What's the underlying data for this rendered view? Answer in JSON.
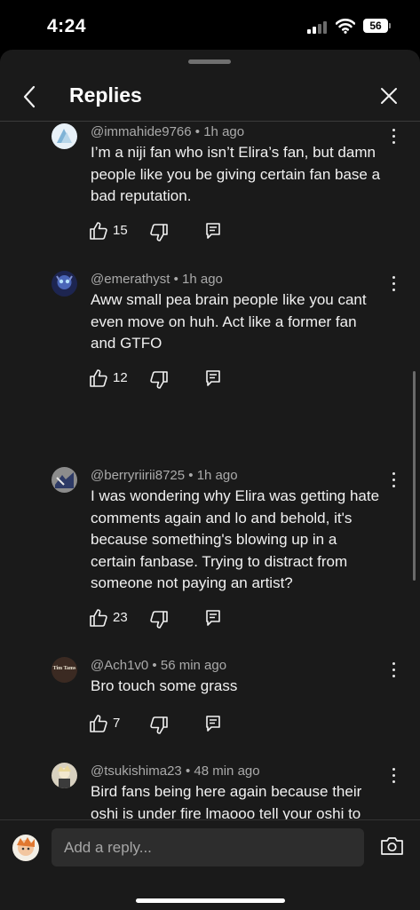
{
  "status_bar": {
    "time": "4:24",
    "battery": "56"
  },
  "header": {
    "title": "Replies"
  },
  "comments": [
    {
      "author": "@immahide9766",
      "time": "1h ago",
      "text": "I’m a niji fan who isn’t Elira’s fan, but damn people like you be giving certain fan base a bad reputation.",
      "likes": "15"
    },
    {
      "author": "@emerathyst",
      "time": "1h ago",
      "text": "Aww small pea brain people like you cant even move on huh. Act like a former fan and GTFO",
      "likes": "12"
    },
    {
      "author": "@berryriirii8725",
      "time": "1h ago",
      "text": "I was wondering why Elira was getting hate comments again and lo and behold, it's because something's blowing up in a certain fanbase. Trying to distract from someone not paying an artist?",
      "likes": "23"
    },
    {
      "author": "@Ach1v0",
      "time": "56 min ago",
      "text": "Bro touch some grass",
      "likes": "7",
      "avatar_text": "Tim Tams"
    },
    {
      "author": "@tsukishima23",
      "time": "48 min ago",
      "text": "Bird fans being here again because their oshi is under fire lmaooo tell your oshi to pay artists and stop always blaming the management.",
      "likes": ""
    }
  ],
  "composer": {
    "placeholder": "Add a reply..."
  },
  "icons": {
    "back": "chevron-left-icon",
    "close": "close-icon",
    "like": "thumbs-up-icon",
    "dislike": "thumbs-down-icon",
    "reply": "reply-icon",
    "more": "more-vert-icon",
    "camera": "camera-icon"
  },
  "colors": {
    "background": "#1a1a1a",
    "meta_text": "#aaaaaa",
    "input_bg": "#2d2d2d"
  }
}
